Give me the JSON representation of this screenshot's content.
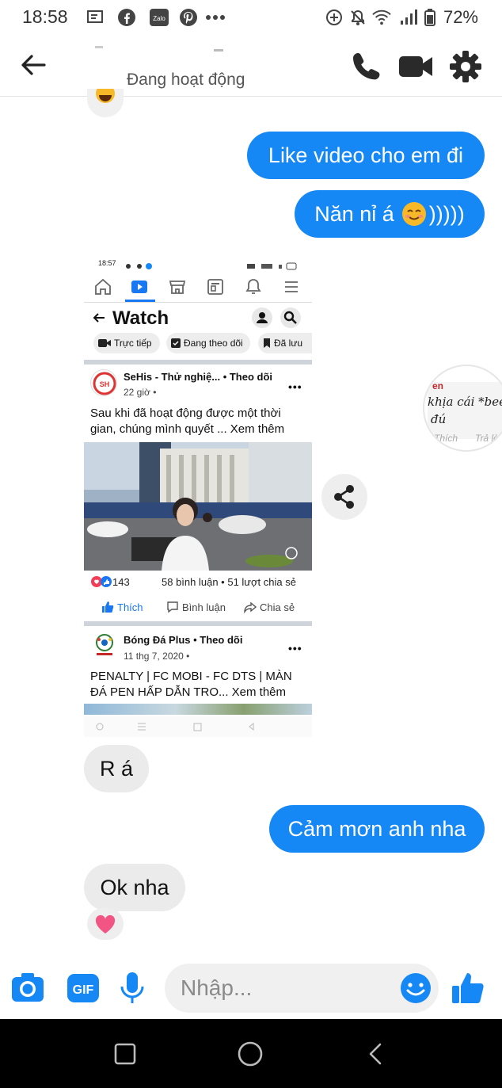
{
  "status_bar": {
    "time": "18:58",
    "battery": "72%",
    "left_icons": [
      "message-icon",
      "facebook-icon",
      "zalo-icon",
      "pinterest-icon",
      "more-dots-icon"
    ],
    "right_icons": [
      "data-saver-icon",
      "mute-icon",
      "wifi-icon",
      "signal-icon",
      "battery-icon"
    ],
    "zalo_label": "Zalo"
  },
  "header": {
    "contact_status": "Đang hoạt động",
    "actions": [
      "phone-icon",
      "video-call-icon",
      "settings-icon"
    ]
  },
  "messages": {
    "out_1": "Like video cho em đi",
    "out_2_text": "Năn nỉ á",
    "out_2_tail": ")))))",
    "in_1": "R á",
    "out_3": "Cảm mơn anh nha",
    "in_2": "Ok nha"
  },
  "shared_screenshot": {
    "time": "18:57",
    "page_title": "Watch",
    "chips": [
      "Trực tiếp",
      "Đang theo dõi",
      "Đã lưu"
    ],
    "post1": {
      "page": "SeHis - Thử nghiệ... • Theo dõi",
      "time": "22 giờ •",
      "text_line1": "Sau khi đã hoạt động được một thời",
      "text_line2": "gian, chúng mình quyết ... Xem thêm",
      "reactions": "143",
      "stats": "58 bình luận • 51 lượt chia sẻ",
      "like": "Thích",
      "comment": "Bình luận",
      "share": "Chia sẻ"
    },
    "post2": {
      "page": "Bóng Đá Plus • Theo dõi",
      "time": "11 thg 7, 2020 •",
      "text_line1": "PENALTY | FC MOBI - FC DTS | MÀN",
      "text_line2": "ĐÁ PEN HẤP DẪN TRO... Xem thêm"
    }
  },
  "preview_bubble": {
    "line1": "khịa cái *beep",
    "line2": "đú",
    "like": "Thích",
    "reply": "Trả lời",
    "top": "en"
  },
  "composer": {
    "placeholder": "Nhập...",
    "gif_label": "GIF"
  },
  "colors": {
    "messenger_blue": "#1588f5",
    "incoming_gray": "#ebebeb"
  }
}
